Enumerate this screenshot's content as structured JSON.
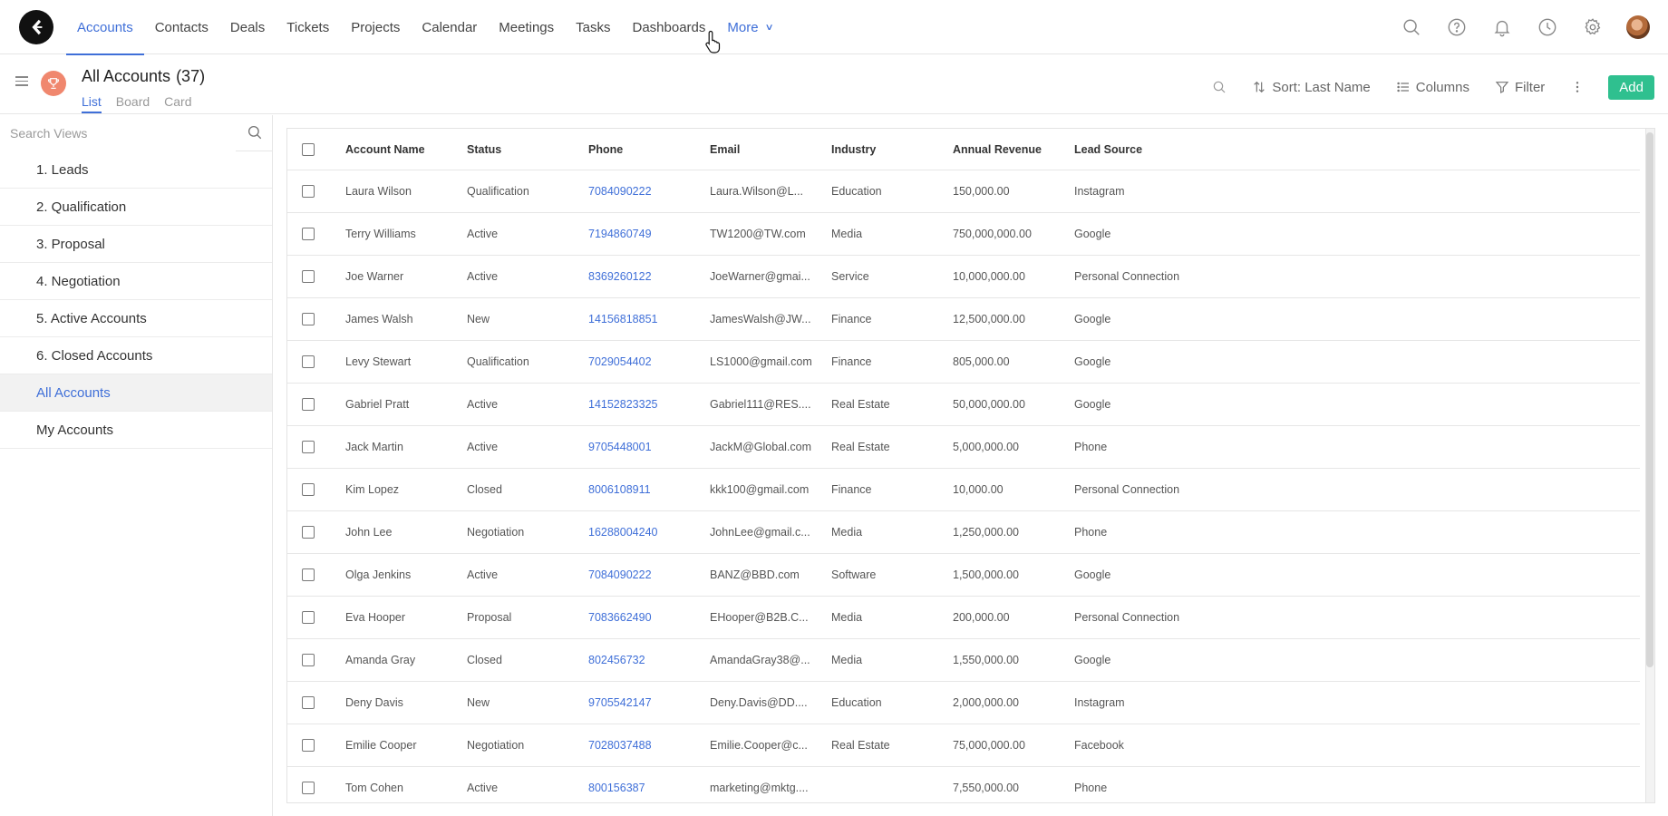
{
  "nav": {
    "tabs": [
      "Accounts",
      "Contacts",
      "Deals",
      "Tickets",
      "Projects",
      "Calendar",
      "Meetings",
      "Tasks",
      "Dashboards"
    ],
    "active_tab": "Accounts",
    "more_label": "More"
  },
  "header": {
    "title": "All Accounts",
    "count": "(37)",
    "view_tabs": [
      "List",
      "Board",
      "Card"
    ],
    "active_view": "List",
    "sort_label": "Sort: Last Name",
    "columns_label": "Columns",
    "filter_label": "Filter",
    "add_label": "Add"
  },
  "sidebar": {
    "search_placeholder": "Search Views",
    "items": [
      "1. Leads",
      "2. Qualification",
      "3. Proposal",
      "4. Negotiation",
      "5. Active Accounts",
      "6. Closed Accounts",
      "All Accounts",
      "My Accounts"
    ],
    "active_item": "All Accounts"
  },
  "table": {
    "columns": [
      "Account Name",
      "Status",
      "Phone",
      "Email",
      "Industry",
      "Annual Revenue",
      "Lead Source"
    ],
    "rows": [
      [
        "Laura Wilson",
        "Qualification",
        "7084090222",
        "Laura.Wilson@L...",
        "Education",
        "150,000.00",
        "Instagram"
      ],
      [
        "Terry Williams",
        "Active",
        "7194860749",
        "TW1200@TW.com",
        "Media",
        "750,000,000.00",
        "Google"
      ],
      [
        "Joe Warner",
        "Active",
        "8369260122",
        "JoeWarner@gmai...",
        "Service",
        "10,000,000.00",
        "Personal Connection"
      ],
      [
        "James Walsh",
        "New",
        "14156818851",
        "JamesWalsh@JW...",
        "Finance",
        "12,500,000.00",
        "Google"
      ],
      [
        "Levy Stewart",
        "Qualification",
        "7029054402",
        "LS1000@gmail.com",
        "Finance",
        "805,000.00",
        "Google"
      ],
      [
        "Gabriel Pratt",
        "Active",
        "14152823325",
        "Gabriel111@RES....",
        "Real Estate",
        "50,000,000.00",
        "Google"
      ],
      [
        "Jack Martin",
        "Active",
        "9705448001",
        "JackM@Global.com",
        "Real Estate",
        "5,000,000.00",
        "Phone"
      ],
      [
        "Kim Lopez",
        "Closed",
        "8006108911",
        "kkk100@gmail.com",
        "Finance",
        "10,000.00",
        "Personal Connection"
      ],
      [
        "John Lee",
        "Negotiation",
        "16288004240",
        "JohnLee@gmail.c...",
        "Media",
        "1,250,000.00",
        "Phone"
      ],
      [
        "Olga Jenkins",
        "Active",
        "7084090222",
        "BANZ@BBD.com",
        "Software",
        "1,500,000.00",
        "Google"
      ],
      [
        "Eva Hooper",
        "Proposal",
        "7083662490",
        "EHooper@B2B.C...",
        "Media",
        "200,000.00",
        "Personal Connection"
      ],
      [
        "Amanda Gray",
        "Closed",
        "802456732",
        "AmandaGray38@...",
        "Media",
        "1,550,000.00",
        "Google"
      ],
      [
        "Deny Davis",
        "New",
        "9705542147",
        "Deny.Davis@DD....",
        "Education",
        "2,000,000.00",
        "Instagram"
      ],
      [
        "Emilie Cooper",
        "Negotiation",
        "7028037488",
        "Emilie.Cooper@c...",
        "Real Estate",
        "75,000,000.00",
        "Facebook"
      ],
      [
        "Tom Cohen",
        "Active",
        "800156387",
        "marketing@mktg....",
        "",
        "7,550,000.00",
        "Phone"
      ]
    ]
  },
  "colors": {
    "accent": "#3f6fd8",
    "add_button": "#2fc08f",
    "trophy_badge": "#f0876e"
  },
  "icons": [
    "logo-icon",
    "search-icon",
    "help-icon",
    "bell-icon",
    "clock-icon",
    "gear-icon",
    "trophy-icon",
    "sort-icon",
    "columns-icon",
    "filter-icon",
    "kebab-icon"
  ]
}
